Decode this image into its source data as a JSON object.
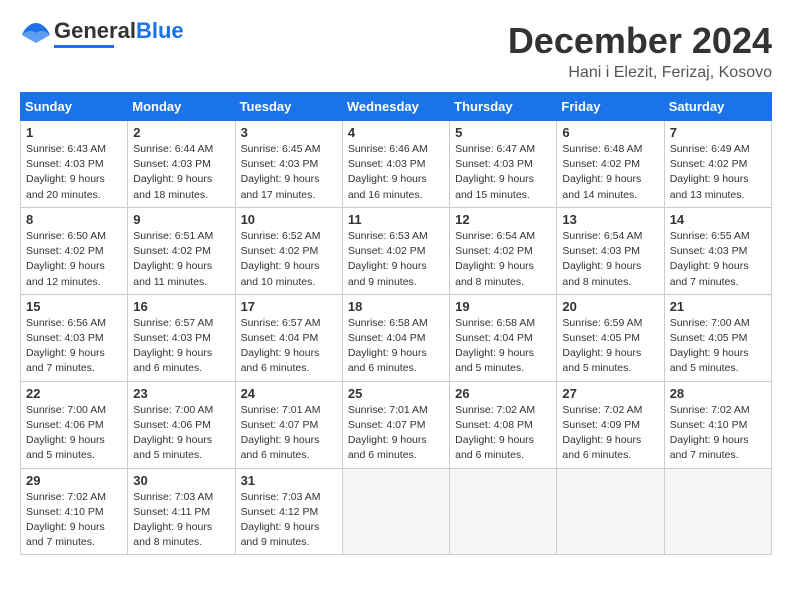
{
  "header": {
    "logo": {
      "general": "General",
      "blue": "Blue"
    },
    "month": "December 2024",
    "location": "Hani i Elezit, Ferizaj, Kosovo"
  },
  "calendar": {
    "weekdays": [
      "Sunday",
      "Monday",
      "Tuesday",
      "Wednesday",
      "Thursday",
      "Friday",
      "Saturday"
    ],
    "weeks": [
      [
        {
          "day": "1",
          "sunrise": "6:43 AM",
          "sunset": "4:03 PM",
          "daylight": "9 hours and 20 minutes."
        },
        {
          "day": "2",
          "sunrise": "6:44 AM",
          "sunset": "4:03 PM",
          "daylight": "9 hours and 18 minutes."
        },
        {
          "day": "3",
          "sunrise": "6:45 AM",
          "sunset": "4:03 PM",
          "daylight": "9 hours and 17 minutes."
        },
        {
          "day": "4",
          "sunrise": "6:46 AM",
          "sunset": "4:03 PM",
          "daylight": "9 hours and 16 minutes."
        },
        {
          "day": "5",
          "sunrise": "6:47 AM",
          "sunset": "4:03 PM",
          "daylight": "9 hours and 15 minutes."
        },
        {
          "day": "6",
          "sunrise": "6:48 AM",
          "sunset": "4:02 PM",
          "daylight": "9 hours and 14 minutes."
        },
        {
          "day": "7",
          "sunrise": "6:49 AM",
          "sunset": "4:02 PM",
          "daylight": "9 hours and 13 minutes."
        }
      ],
      [
        {
          "day": "8",
          "sunrise": "6:50 AM",
          "sunset": "4:02 PM",
          "daylight": "9 hours and 12 minutes."
        },
        {
          "day": "9",
          "sunrise": "6:51 AM",
          "sunset": "4:02 PM",
          "daylight": "9 hours and 11 minutes."
        },
        {
          "day": "10",
          "sunrise": "6:52 AM",
          "sunset": "4:02 PM",
          "daylight": "9 hours and 10 minutes."
        },
        {
          "day": "11",
          "sunrise": "6:53 AM",
          "sunset": "4:02 PM",
          "daylight": "9 hours and 9 minutes."
        },
        {
          "day": "12",
          "sunrise": "6:54 AM",
          "sunset": "4:02 PM",
          "daylight": "9 hours and 8 minutes."
        },
        {
          "day": "13",
          "sunrise": "6:54 AM",
          "sunset": "4:03 PM",
          "daylight": "9 hours and 8 minutes."
        },
        {
          "day": "14",
          "sunrise": "6:55 AM",
          "sunset": "4:03 PM",
          "daylight": "9 hours and 7 minutes."
        }
      ],
      [
        {
          "day": "15",
          "sunrise": "6:56 AM",
          "sunset": "4:03 PM",
          "daylight": "9 hours and 7 minutes."
        },
        {
          "day": "16",
          "sunrise": "6:57 AM",
          "sunset": "4:03 PM",
          "daylight": "9 hours and 6 minutes."
        },
        {
          "day": "17",
          "sunrise": "6:57 AM",
          "sunset": "4:04 PM",
          "daylight": "9 hours and 6 minutes."
        },
        {
          "day": "18",
          "sunrise": "6:58 AM",
          "sunset": "4:04 PM",
          "daylight": "9 hours and 6 minutes."
        },
        {
          "day": "19",
          "sunrise": "6:58 AM",
          "sunset": "4:04 PM",
          "daylight": "9 hours and 5 minutes."
        },
        {
          "day": "20",
          "sunrise": "6:59 AM",
          "sunset": "4:05 PM",
          "daylight": "9 hours and 5 minutes."
        },
        {
          "day": "21",
          "sunrise": "7:00 AM",
          "sunset": "4:05 PM",
          "daylight": "9 hours and 5 minutes."
        }
      ],
      [
        {
          "day": "22",
          "sunrise": "7:00 AM",
          "sunset": "4:06 PM",
          "daylight": "9 hours and 5 minutes."
        },
        {
          "day": "23",
          "sunrise": "7:00 AM",
          "sunset": "4:06 PM",
          "daylight": "9 hours and 5 minutes."
        },
        {
          "day": "24",
          "sunrise": "7:01 AM",
          "sunset": "4:07 PM",
          "daylight": "9 hours and 6 minutes."
        },
        {
          "day": "25",
          "sunrise": "7:01 AM",
          "sunset": "4:07 PM",
          "daylight": "9 hours and 6 minutes."
        },
        {
          "day": "26",
          "sunrise": "7:02 AM",
          "sunset": "4:08 PM",
          "daylight": "9 hours and 6 minutes."
        },
        {
          "day": "27",
          "sunrise": "7:02 AM",
          "sunset": "4:09 PM",
          "daylight": "9 hours and 6 minutes."
        },
        {
          "day": "28",
          "sunrise": "7:02 AM",
          "sunset": "4:10 PM",
          "daylight": "9 hours and 7 minutes."
        }
      ],
      [
        {
          "day": "29",
          "sunrise": "7:02 AM",
          "sunset": "4:10 PM",
          "daylight": "9 hours and 7 minutes."
        },
        {
          "day": "30",
          "sunrise": "7:03 AM",
          "sunset": "4:11 PM",
          "daylight": "9 hours and 8 minutes."
        },
        {
          "day": "31",
          "sunrise": "7:03 AM",
          "sunset": "4:12 PM",
          "daylight": "9 hours and 9 minutes."
        },
        null,
        null,
        null,
        null
      ]
    ]
  }
}
